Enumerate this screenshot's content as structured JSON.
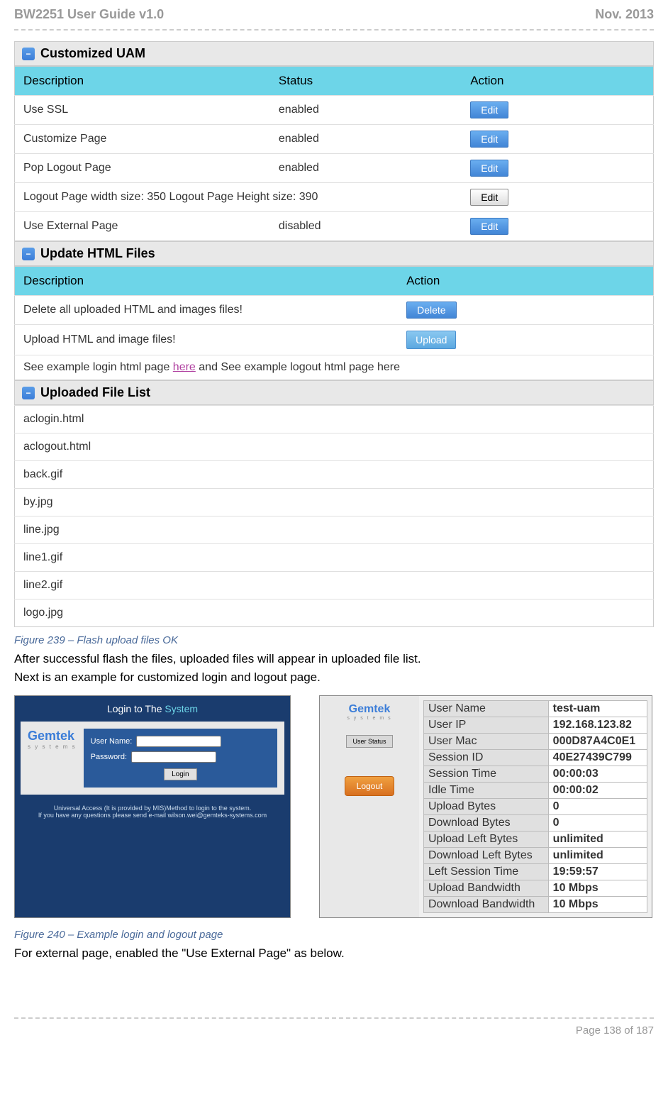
{
  "doc_header_left": "BW2251 User Guide v1.0",
  "doc_header_right": "Nov.  2013",
  "customized_uam": {
    "title": "Customized UAM",
    "headers": [
      "Description",
      "Status",
      "Action"
    ],
    "rows": [
      {
        "desc": "Use SSL",
        "status": "enabled",
        "action": "Edit"
      },
      {
        "desc": "Customize Page",
        "status": "enabled",
        "action": "Edit"
      },
      {
        "desc": "Pop Logout Page",
        "status": "enabled",
        "action": "Edit"
      },
      {
        "desc": "Logout Page width size: 350  Logout Page Height size: 390",
        "status": "",
        "action": "Edit"
      },
      {
        "desc": "Use External Page",
        "status": "disabled",
        "action": "Edit"
      }
    ]
  },
  "update_html": {
    "title": "Update HTML Files",
    "headers": [
      "Description",
      "Action"
    ],
    "rows": [
      {
        "desc": "Delete all uploaded HTML and images files!",
        "action": "Delete"
      },
      {
        "desc": "Upload HTML and image files!",
        "action": "Upload"
      }
    ],
    "example_pre": "See example login html page ",
    "example_link": "here",
    "example_post": " and See example logout html page here"
  },
  "uploaded_files": {
    "title": "Uploaded File List",
    "items": [
      "aclogin.html",
      "aclogout.html",
      "back.gif",
      "by.jpg",
      "line.jpg",
      "line1.gif",
      "line2.gif",
      "logo.jpg"
    ]
  },
  "fig239": "Figure 239 – Flash upload files OK",
  "text1": "After successful flash the files, uploaded files will appear in uploaded file list.",
  "text2": "Next is an example for customized login and logout page.",
  "login": {
    "title_pre": "Login to The ",
    "title_hl": "System",
    "logo": "Gemtek",
    "logo_sub": "s y s t e m s",
    "username_label": "User Name:",
    "password_label": "Password:",
    "button": "Login",
    "footer1": "Universal Access (It is provided by MIS)Method to login to the system.",
    "footer2": "If you have any questions please send e-mail wilson.wei@gemteks-systems.com"
  },
  "logout": {
    "logo": "Gemtek",
    "logo_sub": "s y s t e m s",
    "user_status": "User Status",
    "button": "Logout",
    "rows": [
      {
        "label": "User Name",
        "value": "test-uam"
      },
      {
        "label": "User IP",
        "value": "192.168.123.82"
      },
      {
        "label": "User Mac",
        "value": "000D87A4C0E1"
      },
      {
        "label": "Session ID",
        "value": "40E27439C799"
      },
      {
        "label": "Session Time",
        "value": "00:00:03"
      },
      {
        "label": "Idle Time",
        "value": "00:00:02"
      },
      {
        "label": "Upload Bytes",
        "value": "0"
      },
      {
        "label": "Download Bytes",
        "value": "0"
      },
      {
        "label": "Upload Left Bytes",
        "value": "unlimited"
      },
      {
        "label": "Download Left Bytes",
        "value": "unlimited"
      },
      {
        "label": "Left Session Time",
        "value": "19:59:57"
      },
      {
        "label": "Upload Bandwidth",
        "value": "10 Mbps"
      },
      {
        "label": "Download Bandwidth",
        "value": "10 Mbps"
      }
    ]
  },
  "fig240": "Figure 240 – Example login and logout page",
  "text3": "For external page, enabled the \"Use External Page\" as below.",
  "footer": "Page 138 of 187"
}
